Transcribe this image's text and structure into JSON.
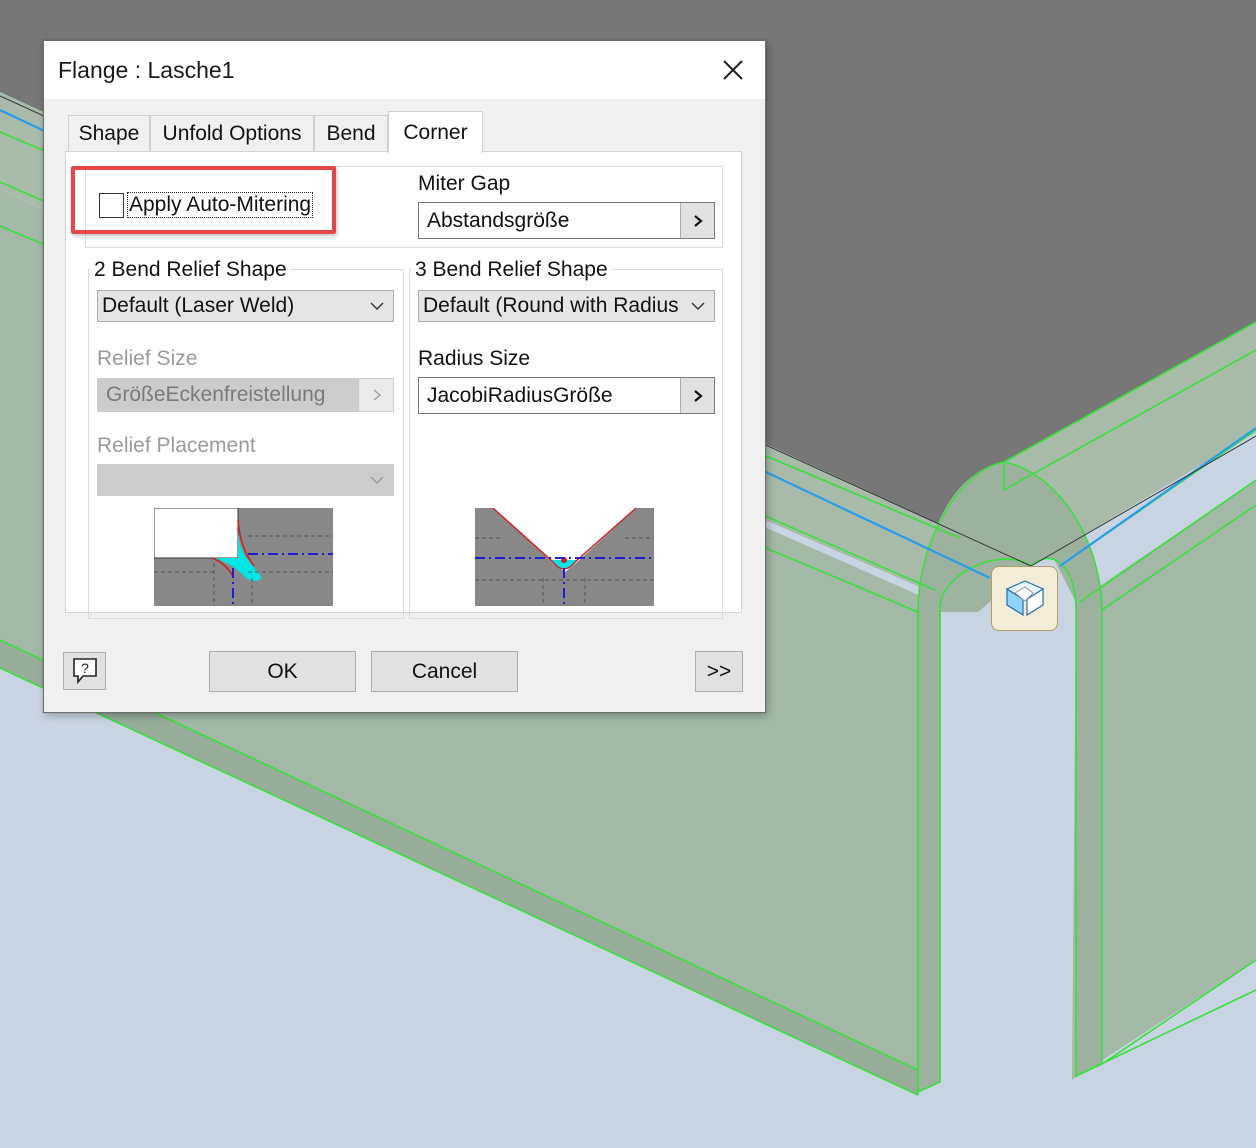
{
  "dialog": {
    "title": "Flange : Lasche1",
    "tabs": [
      {
        "label": "Shape"
      },
      {
        "label": "Unfold Options"
      },
      {
        "label": "Bend"
      },
      {
        "label": "Corner"
      }
    ],
    "active_tab": "Corner",
    "auto_mitering": {
      "label": "Apply Auto-Mitering",
      "checked": false
    },
    "miter_gap": {
      "label": "Miter Gap",
      "value": "Abstandsgröße"
    },
    "bend2": {
      "title": "2 Bend Relief Shape",
      "shape_value": "Default (Laser Weld)",
      "relief_size_label": "Relief Size",
      "relief_size_value": "GrößeEckenfreistellung",
      "relief_placement_label": "Relief Placement",
      "relief_placement_value": ""
    },
    "bend3": {
      "title": "3 Bend Relief Shape",
      "shape_value": "Default (Round with Radius",
      "radius_size_label": "Radius Size",
      "radius_size_value": "JacobiRadiusGröße"
    },
    "buttons": {
      "ok": "OK",
      "cancel": "Cancel",
      "more": ">>"
    }
  },
  "colors": {
    "highlight": "#e4474a",
    "viewport_background": "#c9d4e2",
    "part_face": "#a3b8a6",
    "top_face": "#777777",
    "edge_green": "#38e03c",
    "edge_blue": "#2a9cf0",
    "relief_cyan": "#00e5e5"
  },
  "viewport": {
    "gizmo_icon": "corner-relief-glyph-icon"
  }
}
